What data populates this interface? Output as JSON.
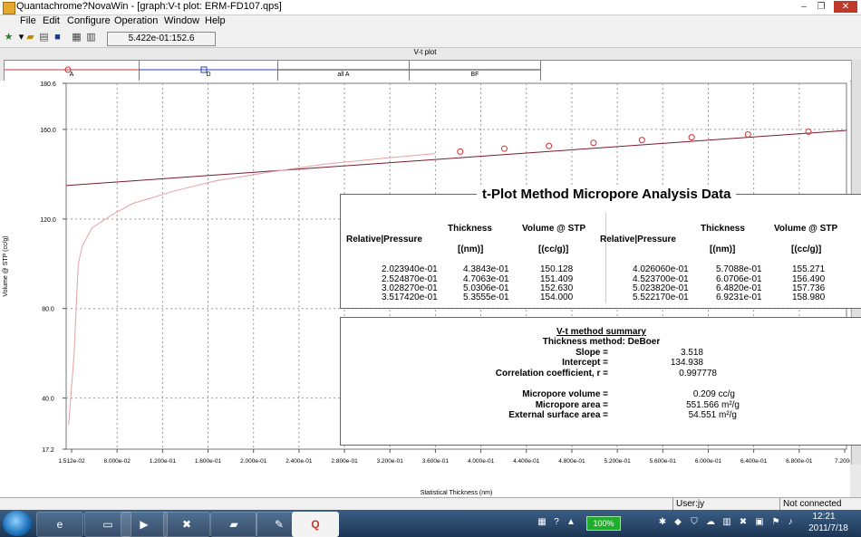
{
  "window": {
    "title": "Quantachrome?NovaWin - [graph:V-t plot: ERM-FD107.qps]",
    "controls": {
      "minimize": "–",
      "restore": "❐",
      "close": "✕"
    }
  },
  "menu": [
    "File",
    "Edit",
    "Configure",
    "Operation",
    "Window",
    "Help"
  ],
  "toolbar": {
    "coord_readout": "5.422e-01:152.6"
  },
  "plot_caption": "V-t plot",
  "legend": [
    {
      "label": "A",
      "color": "#d03030",
      "marker": "circle"
    },
    {
      "label": "D",
      "color": "#2040c0",
      "marker": "square"
    },
    {
      "label": "all A",
      "color": "#333333",
      "marker": "none"
    },
    {
      "label": "BF",
      "color": "#333333",
      "marker": "none"
    }
  ],
  "chart_data": {
    "type": "line",
    "xlabel": "Statistical Thickness (nm)",
    "ylabel": "Volume @ STP (cc/g)",
    "xlim": [
      0.1512,
      0.72
    ],
    "ylim": [
      17.2,
      180.6
    ],
    "x_ticks": [
      "1.512e-02",
      "8.000e-02",
      "1.200e-01",
      "1.600e-01",
      "2.000e-01",
      "2.400e-01",
      "2.800e-01",
      "3.200e-01",
      "3.600e-01",
      "4.000e-01",
      "4.400e-01",
      "4.800e-01",
      "5.200e-01",
      "5.600e-01",
      "6.000e-01",
      "6.400e-01",
      "6.800e-01",
      "7.200e-"
    ],
    "y_ticks": [
      "180.6",
      "160.0",
      "120.0",
      "80.0",
      "40.0",
      "17.2"
    ],
    "grid": true,
    "fit_line": {
      "slope": 3.518,
      "intercept": 134.938,
      "color": "#7a1a2a"
    },
    "series": [
      {
        "name": "A",
        "type": "line",
        "color": "#e8a0a0",
        "x": [
          0.153,
          0.157,
          0.16,
          0.163,
          0.17,
          0.185,
          0.2,
          0.23,
          0.26,
          0.3,
          0.34,
          0.38,
          0.42
        ],
        "y": [
          28.0,
          60.0,
          100.0,
          108.0,
          116.0,
          122.0,
          127.0,
          132.5,
          137.0,
          141.0,
          144.5,
          147.0,
          149.2
        ]
      },
      {
        "name": "A points",
        "type": "scatter",
        "color": "#d03030",
        "x": [
          0.4384,
          0.4706,
          0.5031,
          0.5356,
          0.5709,
          0.6071,
          0.6482,
          0.6923
        ],
        "y": [
          150.128,
          151.409,
          152.63,
          154.0,
          155.271,
          156.49,
          157.736,
          158.98
        ]
      }
    ]
  },
  "results": {
    "title": "t-Plot Method Micropore Analysis Data",
    "headers": {
      "rel_pressure": "Relative|Pressure",
      "thickness": "Thickness",
      "thickness_unit": "[(nm)]",
      "volume": "Volume @ STP",
      "volume_unit": "[(cc/g)]"
    },
    "left_rows": [
      [
        "2.023940e-01",
        "4.3843e-01",
        "150.128"
      ],
      [
        "2.524870e-01",
        "4.7063e-01",
        "151.409"
      ],
      [
        "3.028270e-01",
        "5.0306e-01",
        "152.630"
      ],
      [
        "3.517420e-01",
        "5.3555e-01",
        "154.000"
      ]
    ],
    "right_rows": [
      [
        "4.026060e-01",
        "5.7088e-01",
        "155.271"
      ],
      [
        "4.523700e-01",
        "6.0706e-01",
        "156.490"
      ],
      [
        "5.023820e-01",
        "6.4820e-01",
        "157.736"
      ],
      [
        "5.522170e-01",
        "6.9231e-01",
        "158.980"
      ]
    ]
  },
  "summary": {
    "title": "V-t method summary",
    "method": "Thickness method: DeBoer",
    "rows": [
      {
        "label": "Slope =",
        "value": "3.518"
      },
      {
        "label": "Intercept =",
        "value": "134.938"
      },
      {
        "label": "Correlation coefficient, r  =",
        "value": "0.997778"
      },
      {
        "label": "Micropore volume =",
        "value": "0.209 cc/g"
      },
      {
        "label": "Micropore area =",
        "value": "551.566 m²/g"
      },
      {
        "label": "External surface area =",
        "value": "54.551 m²/g"
      }
    ]
  },
  "status": {
    "user": "User:jy",
    "connection": "Not connected"
  },
  "taskbar": {
    "battery": "100%",
    "time": "12:21",
    "date": "2011/7/18",
    "apps": [
      "ie-icon",
      "explorer-icon",
      "media-player-icon",
      "security-icon",
      "folder-icon",
      "paint-icon",
      "novawin-icon"
    ]
  },
  "colors": {
    "grid": "#9a9a9a",
    "fit": "#7a1a2a",
    "isotherm": "#e8a0a0",
    "points": "#d03030"
  }
}
